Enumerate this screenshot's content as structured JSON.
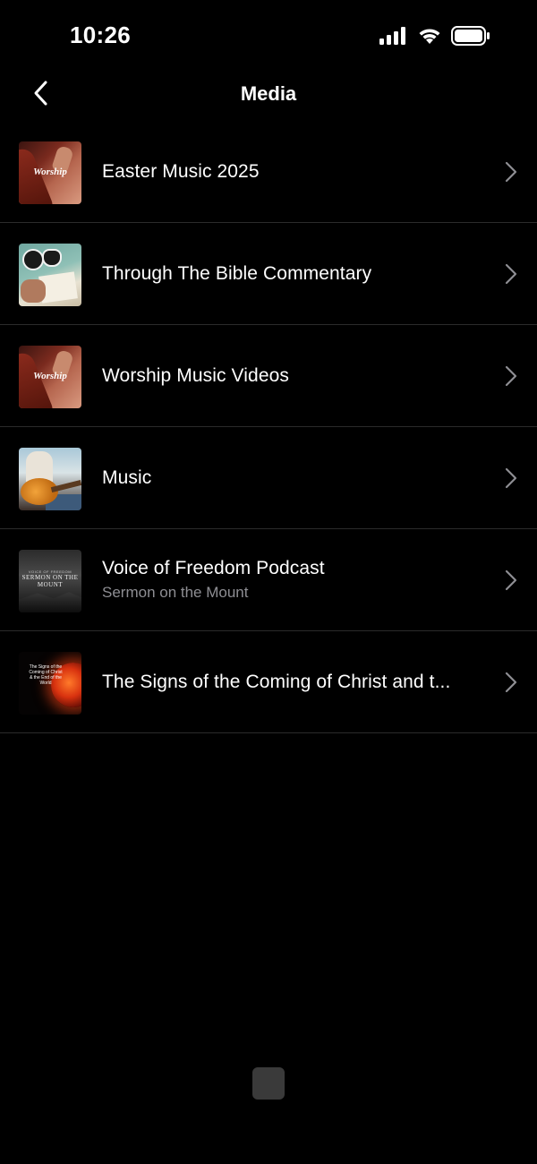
{
  "status_bar": {
    "time": "10:26",
    "icons": [
      "signal-icon",
      "wifi-icon",
      "battery-icon"
    ]
  },
  "nav": {
    "title": "Media",
    "back_icon": "chevron-left-icon"
  },
  "media_items": [
    {
      "title": "Easter Music 2025",
      "subtitle": "",
      "thumbnail": "worship-thumbnail",
      "thumbnail_text": "Worship"
    },
    {
      "title": "Through The Bible Commentary",
      "subtitle": "",
      "thumbnail": "bible-study-thumbnail"
    },
    {
      "title": "Worship Music Videos",
      "subtitle": "",
      "thumbnail": "worship-thumbnail",
      "thumbnail_text": "Worship"
    },
    {
      "title": "Music",
      "subtitle": "",
      "thumbnail": "guitar-thumbnail"
    },
    {
      "title": "Voice of Freedom Podcast",
      "subtitle": "Sermon on the Mount",
      "thumbnail": "sermon-thumbnail",
      "thumbnail_text": "SERMON ON THE MOUNT",
      "thumbnail_small_text": "VOICE OF FREEDOM"
    },
    {
      "title": "The Signs of the Coming of Christ and t...",
      "subtitle": "",
      "thumbnail": "signs-thumbnail",
      "thumbnail_text": "The Signs of the Coming of Christ & the End of the World"
    }
  ],
  "colors": {
    "background": "#000000",
    "separator": "#2b2b2b",
    "subtitle": "#8e8e93",
    "chevron": "#8e8e93"
  }
}
